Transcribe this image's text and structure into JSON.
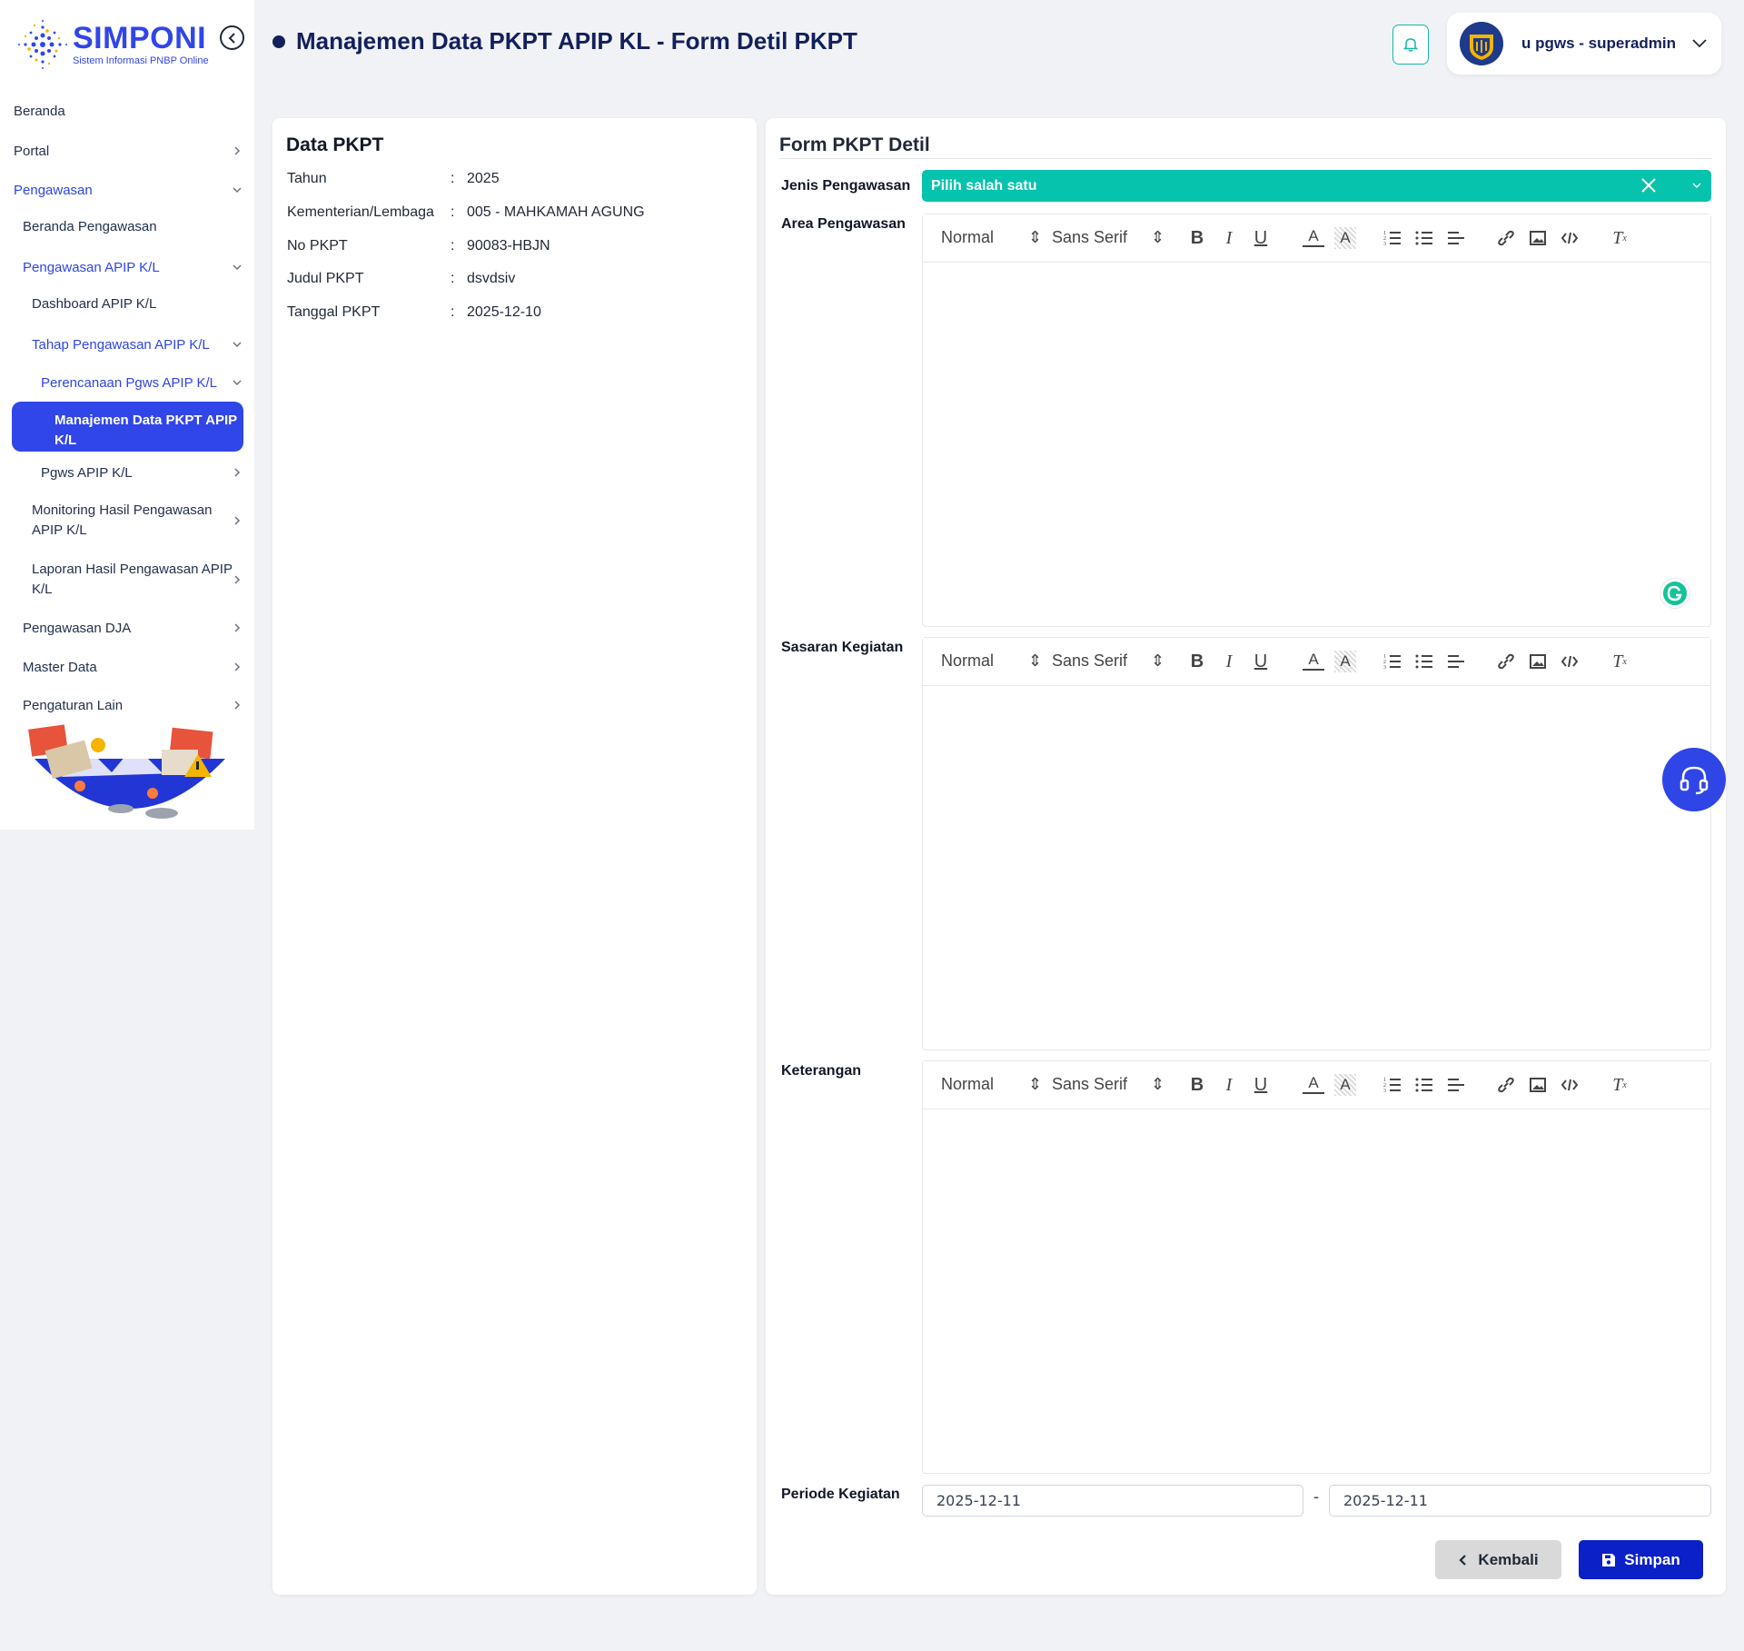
{
  "brand": {
    "title": "SIMPONI",
    "subtitle": "Sistem Informasi PNBP Online"
  },
  "sidebar": {
    "items": [
      {
        "label": "Beranda"
      },
      {
        "label": "Portal"
      },
      {
        "label": "Pengawasan"
      },
      {
        "label": "Beranda Pengawasan"
      },
      {
        "label": "Pengawasan APIP K/L"
      },
      {
        "label": "Dashboard APIP K/L"
      },
      {
        "label": "Tahap Pengawasan APIP K/L"
      },
      {
        "label": "Perencanaan Pgws APIP K/L"
      },
      {
        "label": "Manajemen Data PKPT APIP K/L"
      },
      {
        "label": "Pgws APIP K/L"
      },
      {
        "label": "Monitoring Hasil Pengawasan APIP K/L"
      },
      {
        "label": "Laporan Hasil Pengawasan APIP K/L"
      },
      {
        "label": "Pengawasan DJA"
      },
      {
        "label": "Master Data"
      },
      {
        "label": "Pengaturan Lain"
      }
    ]
  },
  "header": {
    "title": "Manajemen Data PKPT APIP KL - Form Detil PKPT",
    "user": "u pgws - superadmin"
  },
  "data_pkpt": {
    "title": "Data PKPT",
    "rows": [
      {
        "label": "Tahun",
        "value": "2025"
      },
      {
        "label": "Kementerian/Lembaga",
        "value": "005 - MAHKAMAH AGUNG"
      },
      {
        "label": "No PKPT",
        "value": "90083-HBJN"
      },
      {
        "label": "Judul PKPT",
        "value": "dsvdsiv"
      },
      {
        "label": "Tanggal PKPT",
        "value": "2025-12-10"
      }
    ]
  },
  "form": {
    "title": "Form PKPT Detil",
    "jenis_label": "Jenis Pengawasan",
    "jenis_placeholder": "Pilih salah satu",
    "area_label": "Area Pengawasan",
    "sasaran_label": "Sasaran Kegiatan",
    "keterangan_label": "Keterangan",
    "periode_label": "Periode Kegiatan",
    "periode_start": "2025-12-11",
    "periode_sep": "-",
    "periode_end": "2025-12-11",
    "toolbar": {
      "format": "Normal",
      "font": "Sans Serif"
    },
    "back_label": "Kembali",
    "save_label": "Simpan"
  },
  "colors": {
    "primary": "#3046e8",
    "teal": "#05c3ad",
    "save": "#0c20c8",
    "title": "#13205b"
  }
}
